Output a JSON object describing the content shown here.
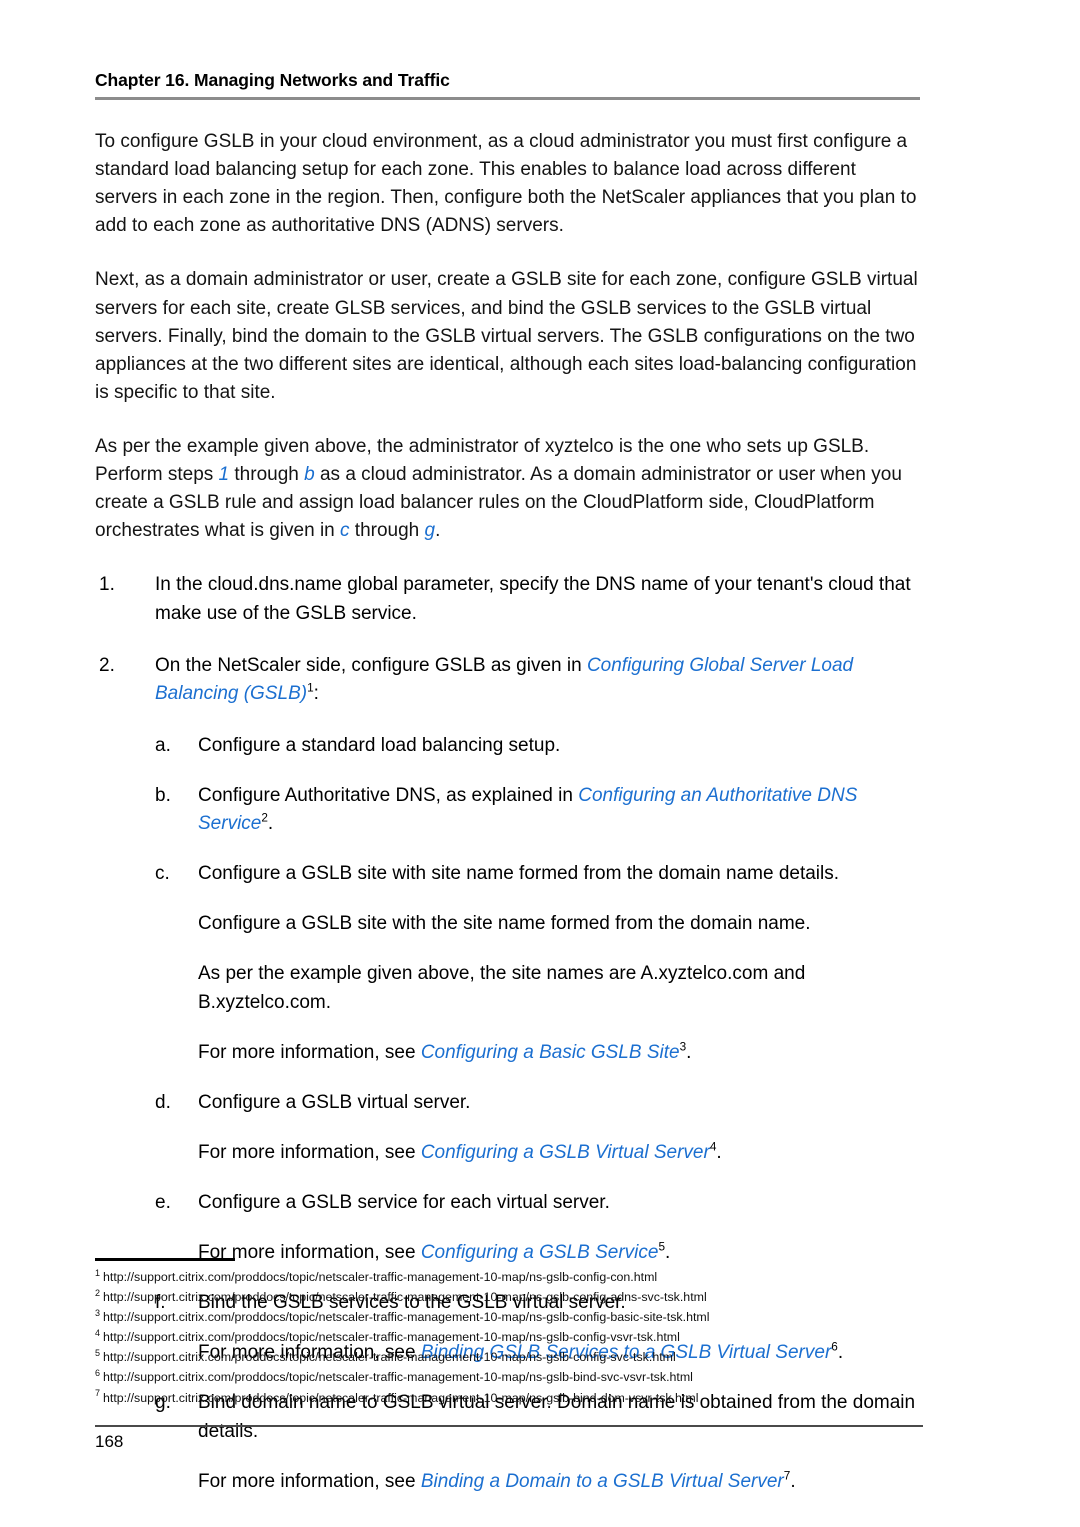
{
  "header": {
    "title": "Chapter 16. Managing Networks and Traffic"
  },
  "body": {
    "paragraph_1": "To configure GSLB in your cloud environment, as a cloud administrator you must first configure a standard load balancing setup for each zone. This enables to balance load across different servers in each zone in the region. Then, configure both the NetScaler appliances that you plan to add to each zone as authoritative DNS (ADNS) servers.",
    "paragraph_2": "Next, as a domain administrator or user, create a GSLB site for each zone, configure GSLB virtual servers for each site, create GLSB services, and bind the GSLB services to the GSLB virtual servers. Finally, bind the domain to the GSLB virtual servers. The GSLB configurations on the two appliances at the two different sites are identical, although each sites load-balancing configuration is specific to that site.",
    "paragraph_3": {
      "part_1": "As per the example given above, the administrator of xyztelco is the one who sets up GSLB. Perform steps ",
      "ref_1": "1",
      "part_2": " through ",
      "ref_2": "b",
      "part_3": " as a cloud administrator. As a domain administrator or user when you create a GSLB rule and assign load balancer rules on the CloudPlatform side, CloudPlatform orchestrates what is given in ",
      "ref_3": "c",
      "part_4": " through ",
      "ref_4": "g",
      "part_5": "."
    }
  },
  "steps": [
    {
      "marker": "1.",
      "text": "In the cloud.dns.name global parameter, specify the DNS name of your tenant's cloud that make use of the GSLB service."
    },
    {
      "marker": "2.",
      "text_before": "On the NetScaler side, configure GSLB as given in ",
      "link": "Configuring Global Server Load Balancing (GSLB)",
      "footnote": "1",
      "text_after": ":"
    }
  ],
  "substeps": [
    {
      "marker": "a.",
      "text": "Configure a standard load balancing setup."
    },
    {
      "marker": "b.",
      "text_before": "Configure Authoritative DNS, as explained in ",
      "link": "Configuring an Authoritative DNS Service",
      "footnote": "2",
      "text_after": "."
    },
    {
      "marker": "c.",
      "text": "Configure a GSLB site with site name formed from the domain name details.",
      "extra_1": "Configure a GSLB site with the site name formed from the domain name.",
      "extra_2": "As per the example given above, the site names are A.xyztelco.com and B.xyztelco.com.",
      "more_info_before": "For more information, see ",
      "more_info_link": "Configuring a Basic GSLB Site",
      "more_info_footnote": "3",
      "more_info_after": "."
    },
    {
      "marker": "d.",
      "text": "Configure a GSLB virtual server.",
      "more_info_before": "For more information, see ",
      "more_info_link": "Configuring a GSLB Virtual Server",
      "more_info_footnote": "4",
      "more_info_after": "."
    },
    {
      "marker": "e.",
      "text": "Configure a GSLB service for each virtual server.",
      "more_info_before": "For more information, see ",
      "more_info_link": "Configuring a GSLB Service",
      "more_info_footnote": "5",
      "more_info_after": "."
    },
    {
      "marker": "f.",
      "text": "Bind the GSLB services to the GSLB virtual server.",
      "more_info_before": "For more information, see ",
      "more_info_link": "Binding GSLB Services to a GSLB Virtual Server",
      "more_info_footnote": "6",
      "more_info_after": "."
    },
    {
      "marker": "g.",
      "text": "Bind domain name to GSLB virtual server. Domain name is obtained from the domain details.",
      "more_info_before": "For more information, see ",
      "more_info_link": "Binding a Domain to a GSLB Virtual Server",
      "more_info_footnote": "7",
      "more_info_after": "."
    }
  ],
  "footnotes": [
    {
      "num": "1",
      "url": "http://support.citrix.com/proddocs/topic/netscaler-traffic-management-10-map/ns-gslb-config-con.html"
    },
    {
      "num": "2",
      "url": "http://support.citrix.com/proddocs/topic/netscaler-traffic-management-10-map/ns-gslb-config-adns-svc-tsk.html"
    },
    {
      "num": "3",
      "url": "http://support.citrix.com/proddocs/topic/netscaler-traffic-management-10-map/ns-gslb-config-basic-site-tsk.html"
    },
    {
      "num": "4",
      "url": "http://support.citrix.com/proddocs/topic/netscaler-traffic-management-10-map/ns-gslb-config-vsvr-tsk.html"
    },
    {
      "num": "5",
      "url": "http://support.citrix.com/proddocs/topic/netscaler-traffic-management-10-map/ns-gslb-config-svc-tsk.html"
    },
    {
      "num": "6",
      "url": "http://support.citrix.com/proddocs/topic/netscaler-traffic-management-10-map/ns-gslb-bind-svc-vsvr-tsk.html"
    },
    {
      "num": "7",
      "url": "http://support.citrix.com/proddocs/topic/netscaler-traffic-management-10-map/ns-gslb-bind-dom-vsvr-tsk.html"
    }
  ],
  "footer": {
    "page_number": "168"
  },
  "colors": {
    "link": "#1b6fd0",
    "header_rule": "#8c8c8c",
    "text": "#141414"
  }
}
